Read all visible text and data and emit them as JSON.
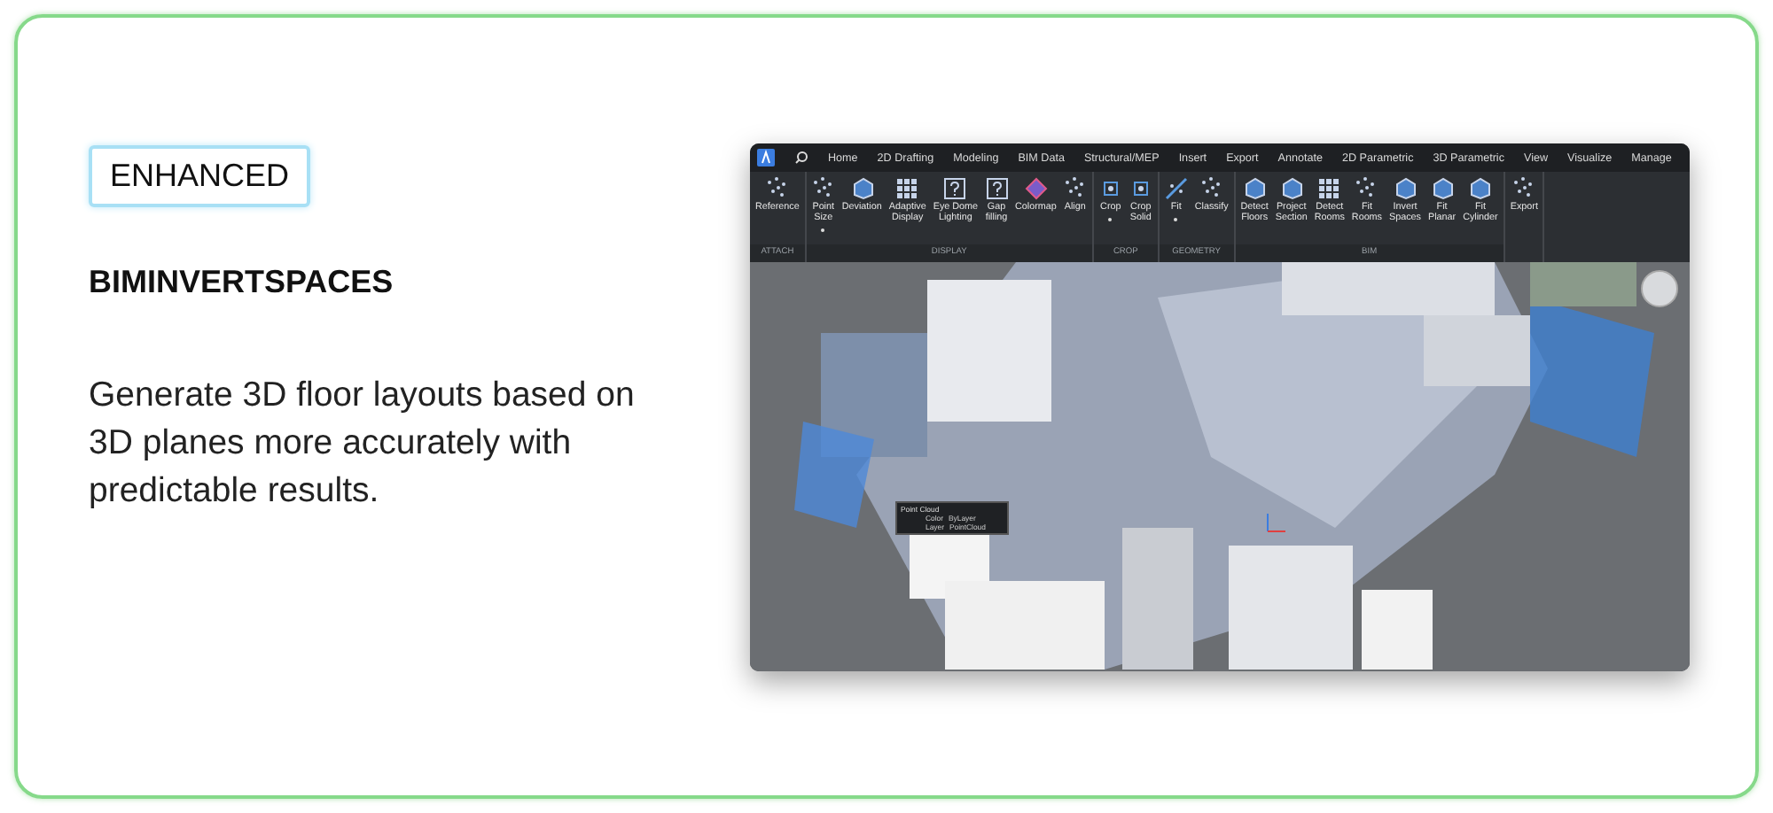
{
  "badge": "ENHANCED",
  "title": "BIMINVERTSPACES",
  "description": "Generate 3D floor layouts based on 3D planes more accurately with predictable results.",
  "app": {
    "tabs": [
      {
        "label": "Home",
        "selected": false
      },
      {
        "label": "2D Drafting",
        "selected": false
      },
      {
        "label": "Modeling",
        "selected": false
      },
      {
        "label": "BIM Data",
        "selected": false
      },
      {
        "label": "Structural/MEP",
        "selected": false
      },
      {
        "label": "Insert",
        "selected": false
      },
      {
        "label": "Export",
        "selected": false
      },
      {
        "label": "Annotate",
        "selected": false
      },
      {
        "label": "2D Parametric",
        "selected": false
      },
      {
        "label": "3D Parametric",
        "selected": false
      },
      {
        "label": "View",
        "selected": false
      },
      {
        "label": "Visualize",
        "selected": false
      },
      {
        "label": "Manage",
        "selected": false
      }
    ],
    "ribbon_groups": [
      {
        "label": "ATTACH",
        "tools": [
          {
            "label": "Reference",
            "has_menu": false
          }
        ]
      },
      {
        "label": "DISPLAY",
        "tools": [
          {
            "label": "Point\nSize",
            "has_menu": true
          },
          {
            "label": "Deviation",
            "has_menu": false
          },
          {
            "label": "Adaptive\nDisplay",
            "has_menu": false
          },
          {
            "label": "Eye Dome\nLighting",
            "has_menu": false
          },
          {
            "label": "Gap\nfilling",
            "has_menu": false
          },
          {
            "label": "Colormap",
            "has_menu": false
          },
          {
            "label": "Align",
            "has_menu": false
          }
        ]
      },
      {
        "label": "CROP",
        "tools": [
          {
            "label": "Crop",
            "has_menu": true
          },
          {
            "label": "Crop\nSolid",
            "has_menu": false
          }
        ]
      },
      {
        "label": "GEOMETRY",
        "tools": [
          {
            "label": "Fit",
            "has_menu": true
          },
          {
            "label": "Classify",
            "has_menu": false
          }
        ]
      },
      {
        "label": "BIM",
        "tools": [
          {
            "label": "Detect\nFloors",
            "has_menu": false
          },
          {
            "label": "Project\nSection",
            "has_menu": false
          },
          {
            "label": "Detect\nRooms",
            "has_menu": false
          },
          {
            "label": "Fit\nRooms",
            "has_menu": false
          },
          {
            "label": "Invert\nSpaces",
            "has_menu": false
          },
          {
            "label": "Fit\nPlanar",
            "has_menu": false
          },
          {
            "label": "Fit\nCylinder",
            "has_menu": false
          }
        ]
      },
      {
        "tools": [
          {
            "label": "Export",
            "has_menu": false
          }
        ]
      }
    ],
    "popup": {
      "title": "Point Cloud",
      "rows": [
        {
          "label": "Color",
          "value": "ByLayer"
        },
        {
          "label": "Layer",
          "value": "PointCloud"
        }
      ]
    }
  }
}
